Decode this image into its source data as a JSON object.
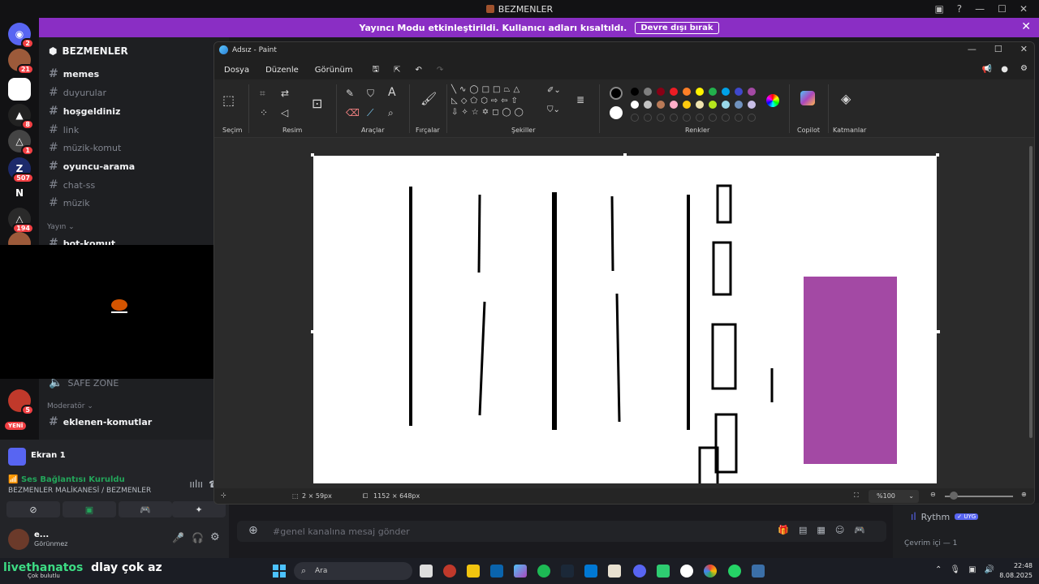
{
  "discord": {
    "window_title": "BEZMENLER",
    "banner_text": "Yayıncı Modu etkinleştirildi. Kullanıcı adları kısaltıldı.",
    "banner_button": "Devre dışı bırak",
    "server_name": "BEZMENLER",
    "server_badges": [
      "2",
      "21",
      "8",
      "1",
      "507",
      "194",
      "5"
    ],
    "server_letter_n": "N",
    "channels": [
      {
        "name": "memes",
        "bright": true
      },
      {
        "name": "duyurular",
        "bright": false
      },
      {
        "name": "hoşgeldiniz",
        "bright": true
      },
      {
        "name": "link",
        "bright": false
      },
      {
        "name": "müzik-komut",
        "bright": false
      },
      {
        "name": "oyuncu-arama",
        "bright": true
      },
      {
        "name": "chat-ss",
        "bright": false
      },
      {
        "name": "müzik",
        "bright": false
      }
    ],
    "category_yayin": "Yayın",
    "channel_bot_komut": "bot-komut",
    "channel_safe_zone": "SAFE ZONE",
    "category_moderator": "Moderatör",
    "channel_eklenen_komutlar": "eklenen-komutlar",
    "new_badge": "YENİ",
    "screen_share_title": "Ekran 1",
    "voice_status": "Ses Bağlantısı Kuruldu",
    "voice_location": "BEZMENLER MALİKANESİ / BEZMENLER",
    "user_name": "e...",
    "user_status": "Görünmez",
    "chat_placeholder": "#genel kanalına mesaj gönder",
    "member_bot_name": "Rythm",
    "member_bot_tag": "✓ UYG",
    "online_header": "Çevrim içi — 1"
  },
  "paint": {
    "title": "Adsız - Paint",
    "menu": [
      "Dosya",
      "Düzenle",
      "Görünüm"
    ],
    "groups": [
      "Seçim",
      "Resim",
      "Araçlar",
      "Fırçalar",
      "Şekiller",
      "Renkler",
      "Copilot",
      "Katmanlar"
    ],
    "status_selection": "2 × 59px",
    "status_canvas_size": "1152 × 648px",
    "zoom": "%100",
    "colors_row1": [
      "#000000",
      "#7f7f7f",
      "#880015",
      "#ed1c24",
      "#ff7f27",
      "#fff200",
      "#22b14c",
      "#00a2e8",
      "#3f48cc",
      "#a349a4"
    ],
    "colors_row2": [
      "#ffffff",
      "#c3c3c3",
      "#b97a57",
      "#ffaec9",
      "#ffc90e",
      "#efe4b0",
      "#b5e61d",
      "#99d9ea",
      "#7092be",
      "#c8bfe7"
    ],
    "primary_color": "#000000",
    "secondary_color": "#ffffff",
    "rectangle_fill": "#a349a4"
  },
  "overlay": {
    "name": "livethanatos",
    "message": "dlay çok az",
    "weather": "Çok bulutlu"
  },
  "taskbar": {
    "search_placeholder": "Ara",
    "time": "22:48",
    "date": "8.08.2025"
  }
}
